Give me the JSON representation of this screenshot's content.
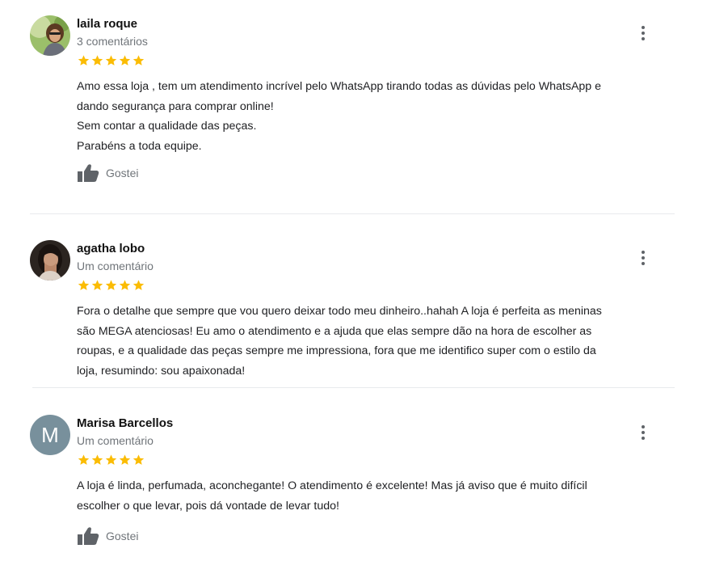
{
  "colors": {
    "star": "#fbbc04",
    "avatar_m": "#78909c"
  },
  "reviews": [
    {
      "author": "laila roque",
      "meta": "3 comentários",
      "rating": 5,
      "text": "Amo essa loja , tem um atendimento incrível pelo WhatsApp tirando todas as dúvidas pelo WhatsApp e\ndando segurança para comprar online!\nSem contar a qualidade das peças.\nParabéns a toda equipe.",
      "like_label": "Gostei"
    },
    {
      "author": "agatha lobo",
      "meta": "Um comentário",
      "rating": 5,
      "text": "Fora o detalhe que sempre que vou quero deixar todo meu dinheiro..hahah A loja é perfeita as meninas\nsão MEGA atenciosas! Eu amo o atendimento e a ajuda que elas sempre dão na hora de escolher as\nroupas, e a qualidade das peças sempre me impressiona, fora que me identifico super com o estilo da\nloja, resumindo: sou apaixonada!"
    },
    {
      "author": "Marisa Barcellos",
      "avatar_letter": "M",
      "meta": "Um comentário",
      "rating": 5,
      "text": "A loja é linda, perfumada, aconchegante! O atendimento é excelente! Mas já aviso que é muito difícil\nescolher o que levar, pois dá vontade de levar tudo!",
      "like_label": "Gostei"
    }
  ]
}
